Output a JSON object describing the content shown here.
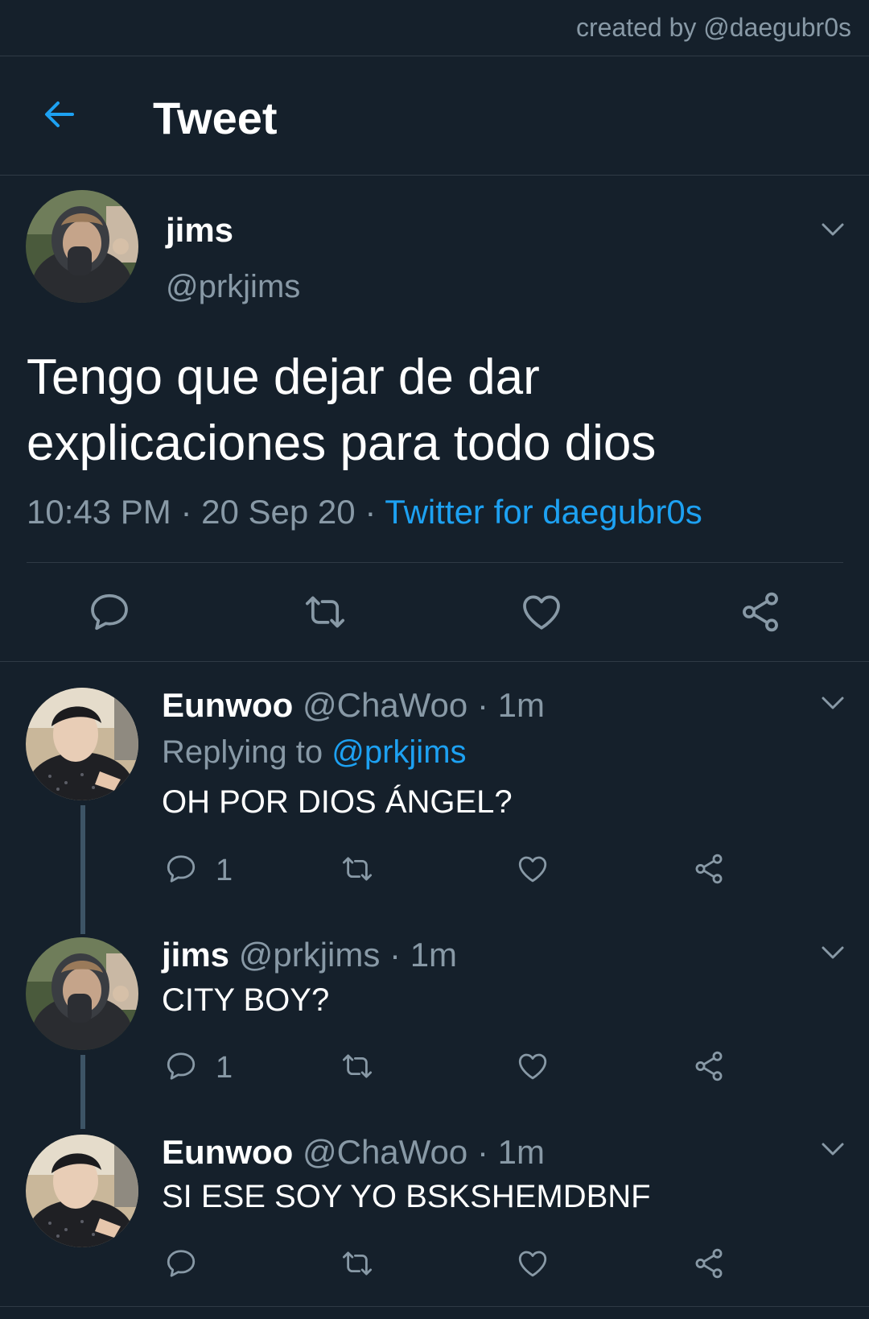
{
  "credit": "created by @daegubr0s",
  "header": {
    "title": "Tweet"
  },
  "main_tweet": {
    "name": "jims",
    "handle": "@prkjims",
    "text": "Tengo que dejar de dar explicaciones para todo dios",
    "time": "10:43 PM",
    "date": "20 Sep 20",
    "source": "Twitter for daegubr0s",
    "sep": "·"
  },
  "replies": [
    {
      "name": "Eunwoo",
      "handle": "@ChaWoo",
      "time": "1m",
      "replying_label": "Replying to",
      "replying_handle": "@prkjims",
      "text": "OH POR DIOS ÁNGEL?",
      "reply_count": "1"
    },
    {
      "name": "jims",
      "handle": "@prkjims",
      "time": "1m",
      "text": "CITY BOY?",
      "reply_count": "1"
    },
    {
      "name": "Eunwoo",
      "handle": "@ChaWoo",
      "time": "1m",
      "text": "SI ESE SOY YO BSKSHEMDBNF"
    }
  ],
  "colors": {
    "background": "#15202b",
    "accent": "#1da1f2",
    "secondary_text": "#8899a6",
    "divider": "#2f3a45"
  },
  "icons": [
    "back-arrow-icon",
    "chevron-down-icon",
    "reply-icon",
    "retweet-icon",
    "like-icon",
    "share-icon"
  ]
}
